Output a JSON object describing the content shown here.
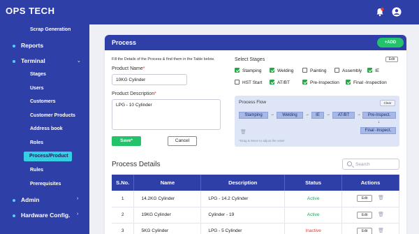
{
  "topbar": {
    "logo": "OPS TECH",
    "icons": [
      "bell-icon",
      "user-icon"
    ]
  },
  "sidebar": {
    "items": [
      {
        "label": "Scrap Generation",
        "type": "sub"
      },
      {
        "label": "Reports",
        "type": "main"
      },
      {
        "label": "Terminal",
        "type": "main"
      },
      {
        "label": "Stages",
        "type": "sub"
      },
      {
        "label": "Users",
        "type": "sub"
      },
      {
        "label": "Customers",
        "type": "sub"
      },
      {
        "label": "Customer Products",
        "type": "sub"
      },
      {
        "label": "Address book",
        "type": "sub"
      },
      {
        "label": "Roles",
        "type": "sub"
      },
      {
        "label": "Process/Product",
        "type": "sub",
        "active": true
      },
      {
        "label": "Rules",
        "type": "sub"
      },
      {
        "label": "Prerequisites",
        "type": "sub"
      },
      {
        "label": "Admin",
        "type": "main"
      },
      {
        "label": "Hardware Config.",
        "type": "main"
      }
    ]
  },
  "card": {
    "title": "Process",
    "add_label": "+ADD"
  },
  "form": {
    "hint": "Fill the Details of the Process & find them in the Table below.",
    "product_name_label": "Product Name",
    "product_name_value": "10KG Cylinder",
    "product_desc_label": "Product Description",
    "product_desc_value": "LPG - 10 Cylinder",
    "required_mark": "*",
    "save_label": "Save*",
    "cancel_label": "Cancel"
  },
  "stages": {
    "label": "Select Stages",
    "edit_label": "Edit",
    "items": [
      {
        "label": "Stamping",
        "checked": true
      },
      {
        "label": "Welding",
        "checked": true
      },
      {
        "label": "Painting",
        "checked": false
      },
      {
        "label": "Assembly",
        "checked": false
      },
      {
        "label": "IE",
        "checked": true
      },
      {
        "label": "HST Start",
        "checked": false
      },
      {
        "label": "AT/BT",
        "checked": true
      },
      {
        "label": "Pre-Inspection",
        "checked": true
      },
      {
        "label": "Final -Inspection",
        "checked": true
      }
    ]
  },
  "flow": {
    "title": "Process Flow",
    "clear_label": "Clear",
    "steps": [
      "Stamping",
      "Welding",
      "IE",
      "AT/BT",
      "Pre-Inspect.",
      "Final -Inspect."
    ],
    "hint": "*Drag & Move to adjust the order"
  },
  "details": {
    "title": "Process Details",
    "search_placeholder": "Search",
    "columns": [
      "S.No.",
      "Name",
      "Description",
      "Status",
      "Actions"
    ],
    "edit_label": "Edit",
    "rows": [
      {
        "sno": "1",
        "name": "14.2KG Cylinder",
        "desc": "LPG - 14.2 Cylinder",
        "status": "Active"
      },
      {
        "sno": "2",
        "name": "19KG Cylinder",
        "desc": "Cylinder - 19",
        "status": "Active"
      },
      {
        "sno": "3",
        "name": "5KG Cylinder",
        "desc": "LPG - 5 Cylinder",
        "status": "Inactive"
      }
    ]
  },
  "colors": {
    "primary": "#2f3fa8",
    "accent": "#22c36b",
    "active_nav": "#35cfe4",
    "inactive": "#e53935"
  }
}
